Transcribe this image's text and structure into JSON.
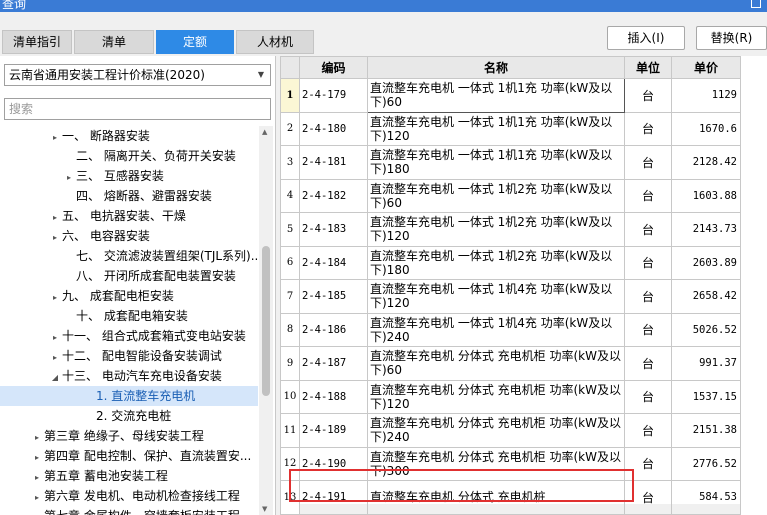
{
  "window": {
    "title": "查询"
  },
  "tabs": [
    {
      "label": "清单指引",
      "active": false
    },
    {
      "label": "清单",
      "active": false
    },
    {
      "label": "定额",
      "active": true
    },
    {
      "label": "人材机",
      "active": false
    }
  ],
  "toolbar": {
    "insert_label": "插入(I)",
    "replace_label": "替换(R)"
  },
  "left": {
    "standard_select": "云南省通用安装工程计价标准(2020)",
    "search_placeholder": "搜索"
  },
  "tree": [
    {
      "label": "一、 断路器安装",
      "toggle": "▸"
    },
    {
      "label": "二、 隔离开关、负荷开关安装",
      "toggle": ""
    },
    {
      "label": "三、 互感器安装",
      "toggle": "▸"
    },
    {
      "label": "四、 熔断器、避雷器安装",
      "toggle": ""
    },
    {
      "label": "五、 电抗器安装、干燥",
      "toggle": "▸"
    },
    {
      "label": "六、 电容器安装",
      "toggle": "▸"
    },
    {
      "label": "七、 交流滤波装置组架(TJL系列)...",
      "toggle": ""
    },
    {
      "label": "八、 开闭所成套配电装置安装",
      "toggle": ""
    },
    {
      "label": "九、 成套配电柜安装",
      "toggle": "▸"
    },
    {
      "label": "十、 成套配电箱安装",
      "toggle": ""
    },
    {
      "label": "十一、 组合式成套箱式变电站安装",
      "toggle": "▸"
    },
    {
      "label": "十二、 配电智能设备安装调试",
      "toggle": "▸"
    },
    {
      "label": "十三、 电动汽车充电设备安装",
      "toggle": "◢"
    },
    {
      "label": "1. 直流整车充电机",
      "toggle": "",
      "selected": true
    },
    {
      "label": "2. 交流充电桩",
      "toggle": ""
    },
    {
      "label": "第三章 绝缘子、母线安装工程",
      "toggle": "▸"
    },
    {
      "label": "第四章 配电控制、保护、直流装置安...",
      "toggle": "▸"
    },
    {
      "label": "第五章 蓄电池安装工程",
      "toggle": "▸"
    },
    {
      "label": "第六章 发电机、电动机检查接线工程",
      "toggle": "▸"
    },
    {
      "label": "第七章 金属构件、穿墙套板安装工程",
      "toggle": "▸"
    }
  ],
  "table": {
    "headers": {
      "code": "编码",
      "name": "名称",
      "unit": "单位",
      "price": "单价"
    },
    "rows": [
      {
        "n": "1",
        "code": "2-4-179",
        "name": "直流整车充电机 一体式 1机1充 功率(kW及以下)60",
        "unit": "台",
        "price": "1129"
      },
      {
        "n": "2",
        "code": "2-4-180",
        "name": "直流整车充电机 一体式 1机1充 功率(kW及以下)120",
        "unit": "台",
        "price": "1670.6"
      },
      {
        "n": "3",
        "code": "2-4-181",
        "name": "直流整车充电机 一体式 1机1充 功率(kW及以下)180",
        "unit": "台",
        "price": "2128.42"
      },
      {
        "n": "4",
        "code": "2-4-182",
        "name": "直流整车充电机 一体式 1机2充 功率(kW及以下)60",
        "unit": "台",
        "price": "1603.88"
      },
      {
        "n": "5",
        "code": "2-4-183",
        "name": "直流整车充电机 一体式 1机2充 功率(kW及以下)120",
        "unit": "台",
        "price": "2143.73"
      },
      {
        "n": "6",
        "code": "2-4-184",
        "name": "直流整车充电机 一体式 1机2充 功率(kW及以下)180",
        "unit": "台",
        "price": "2603.89"
      },
      {
        "n": "7",
        "code": "2-4-185",
        "name": "直流整车充电机 一体式 1机4充 功率(kW及以下)120",
        "unit": "台",
        "price": "2658.42"
      },
      {
        "n": "8",
        "code": "2-4-186",
        "name": "直流整车充电机 一体式 1机4充 功率(kW及以下)240",
        "unit": "台",
        "price": "5026.52"
      },
      {
        "n": "9",
        "code": "2-4-187",
        "name": "直流整车充电机 分体式 充电机柜 功率(kW及以下)60",
        "unit": "台",
        "price": "991.37"
      },
      {
        "n": "10",
        "code": "2-4-188",
        "name": "直流整车充电机 分体式 充电机柜 功率(kW及以下)120",
        "unit": "台",
        "price": "1537.15"
      },
      {
        "n": "11",
        "code": "2-4-189",
        "name": "直流整车充电机 分体式 充电机柜 功率(kW及以下)240",
        "unit": "台",
        "price": "2151.38"
      },
      {
        "n": "12",
        "code": "2-4-190",
        "name": "直流整车充电机 分体式 充电机柜 功率(kW及以下)300",
        "unit": "台",
        "price": "2776.52"
      },
      {
        "n": "13",
        "code": "2-4-191",
        "name": "直流整车充电机 分体式 充电机桩",
        "unit": "台",
        "price": "584.53"
      }
    ]
  },
  "colors": {
    "accent": "#2e8ae6",
    "highlight": "#e03030",
    "selected_row": "#d5e6fa"
  }
}
